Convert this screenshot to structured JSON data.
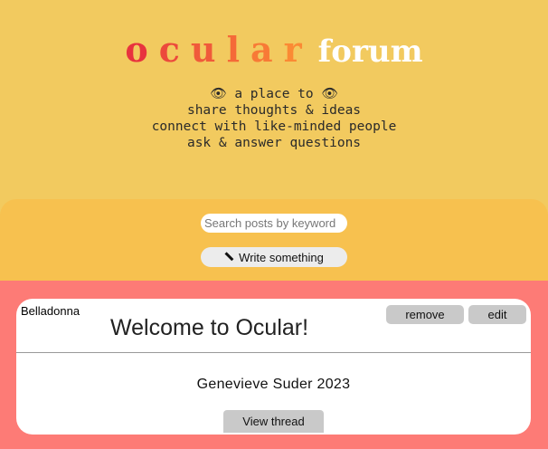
{
  "header": {
    "logo_word_1": [
      "o",
      "c",
      "u",
      "l",
      "a",
      "r"
    ],
    "logo_word_2": "forum",
    "tagline": [
      "👁 a place to 👁",
      "share thoughts & ideas",
      "connect with like-minded people",
      "ask & answer questions"
    ]
  },
  "toolbar": {
    "search_placeholder": "Search posts by keyword",
    "write_label": "Write something",
    "write_icon": "pencil-icon"
  },
  "post": {
    "author": "Belladonna",
    "title": "Welcome to Ocular!",
    "remove_label": "remove",
    "edit_label": "edit",
    "body": "Genevieve Suder 2023",
    "view_label": "View thread"
  },
  "colors": {
    "header_bg": "#f2ca5f",
    "toolbar_bg": "#f7c14f",
    "feed_bg": "#fd7b76",
    "card_bg": "#ffffff",
    "button_bg": "#c9c9c9"
  }
}
